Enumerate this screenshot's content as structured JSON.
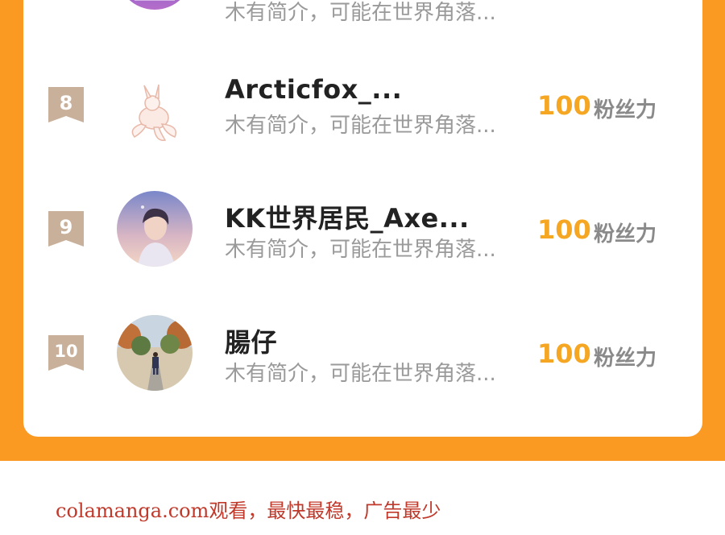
{
  "ranking": {
    "score_unit": "粉丝力",
    "entries": [
      {
        "rank": "",
        "name": "",
        "bio": "木有简介，可能在世界角落...",
        "score": ""
      },
      {
        "rank": "8",
        "name": "Arcticfox_...",
        "bio": "木有简介，可能在世界角落...",
        "score": "100"
      },
      {
        "rank": "9",
        "name": "KK世界居民_Axe...",
        "bio": "木有简介，可能在世界角落...",
        "score": "100"
      },
      {
        "rank": "10",
        "name": "腸仔",
        "bio": "木有简介，可能在世界角落...",
        "score": "100"
      }
    ]
  },
  "footer": {
    "watermark": "colamanga.com观看，最快最稳，广告最少"
  },
  "colors": {
    "frame": "#fb9a22",
    "score": "#f5a623",
    "rank_badge": "#c9b09a",
    "footer_text": "#c0392b"
  }
}
